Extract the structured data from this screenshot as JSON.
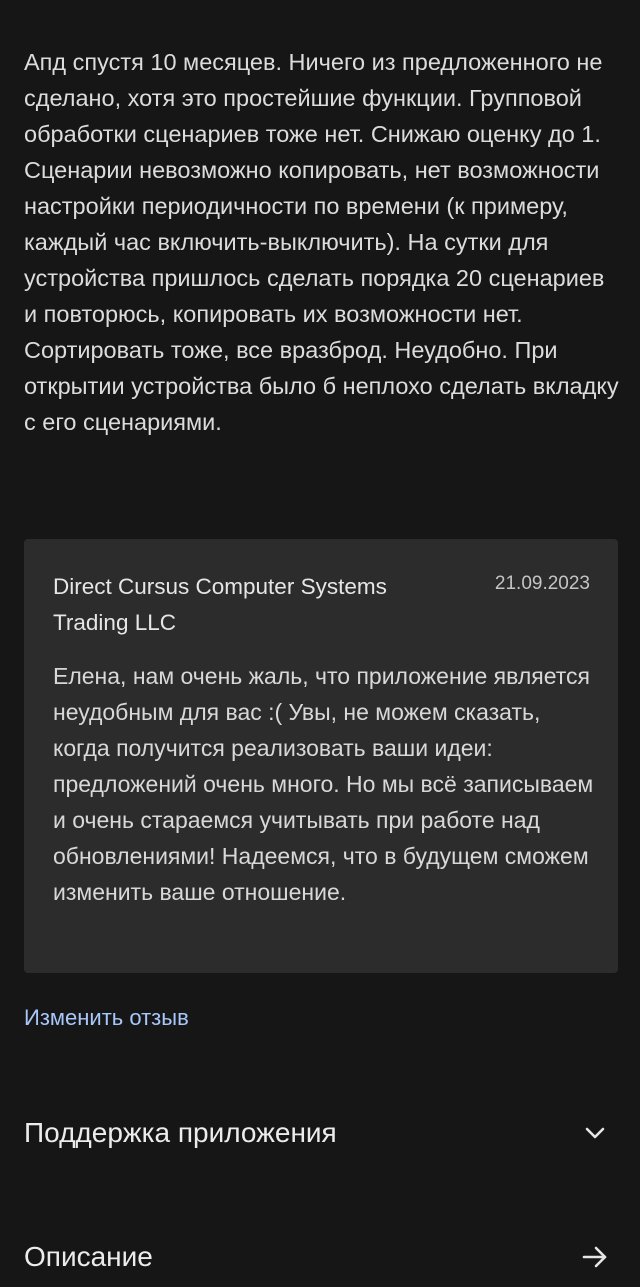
{
  "review": {
    "text": "Апд спустя 10 месяцев. Ничего из предложенного не сделано, хотя это простейшие функции. Групповой обработки сценариев тоже нет. Снижаю оценку до 1. Сценарии невозможно копировать, нет возможности настройки периодичности по времени (к примеру, каждый час включить-выключить). На сутки для устройства пришлось сделать порядка 20 сценариев и повторюсь, копировать их возможности нет. Сортировать тоже, все вразброд. Неудобно. При открытии устройства было б неплохо сделать вкладку с его сценариями."
  },
  "developer_reply": {
    "developer": "Direct Cursus Computer Systems Trading LLC",
    "date": "21.09.2023",
    "text": "Елена, нам очень жаль, что приложение является неудобным для вас :( Увы, не можем сказать, когда получится реализовать ваши идеи: предложений очень много. Но мы всё записываем и очень стараемся учитывать при работе над обновлениями! Надеемся, что в будущем сможем изменить ваше отношение."
  },
  "edit_review_label": "Изменить отзыв",
  "sections": {
    "support": {
      "title": "Поддержка приложения",
      "icon": "chevron-down-icon"
    },
    "description": {
      "title": "Описание",
      "icon": "arrow-right-icon"
    }
  },
  "colors": {
    "background": "#161616",
    "card": "#2c2c2c",
    "link": "#a8c7fa"
  }
}
